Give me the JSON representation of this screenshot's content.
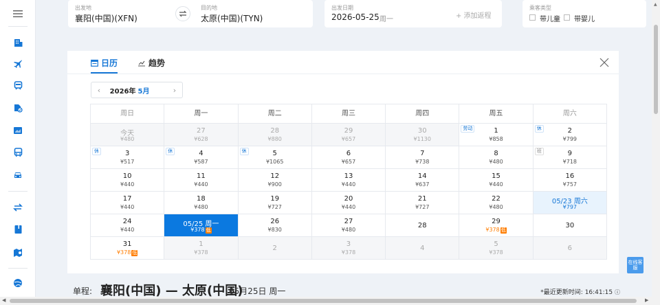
{
  "nav": {
    "icons": [
      "menu-icon",
      "hotel-icon",
      "flight-icon",
      "train-icon",
      "visa-icon",
      "ticket-icon",
      "bus-icon",
      "car-icon",
      "transfer-icon",
      "guide-icon",
      "map-icon",
      "globe-icon"
    ]
  },
  "search": {
    "from_label": "出发地",
    "from_value": "襄阳(中国)(XFN)",
    "to_label": "目的地",
    "to_value": "太原(中国)(TYN)",
    "date_label": "出发日期",
    "date_value": "2026-05-25",
    "date_weekday": "周一",
    "add_return": "+ 添加返程",
    "passenger_label": "乘客类型",
    "child_label": "带儿童",
    "infant_label": "带婴儿"
  },
  "calendar": {
    "tab_calendar": "日历",
    "tab_trend": "趋势",
    "year": "2026年",
    "month": "5月",
    "weekdays": [
      "周日",
      "周一",
      "周二",
      "周三",
      "周四",
      "周五",
      "周六"
    ],
    "rows": [
      [
        {
          "day": "今天",
          "price": "¥480",
          "state": "disabled"
        },
        {
          "day": "27",
          "price": "¥628",
          "state": "disabled"
        },
        {
          "day": "28",
          "price": "¥880",
          "state": "disabled"
        },
        {
          "day": "29",
          "price": "¥657",
          "state": "disabled"
        },
        {
          "day": "30",
          "price": "¥1130",
          "state": "disabled"
        },
        {
          "day": "1",
          "price": "¥858",
          "badge": "劳动"
        },
        {
          "day": "2",
          "price": "¥799",
          "badge": "休"
        }
      ],
      [
        {
          "day": "3",
          "price": "¥517",
          "badge": "休"
        },
        {
          "day": "4",
          "price": "¥587",
          "badge": "休"
        },
        {
          "day": "5",
          "price": "¥1065",
          "badge": "休"
        },
        {
          "day": "6",
          "price": "¥657"
        },
        {
          "day": "7",
          "price": "¥738"
        },
        {
          "day": "8",
          "price": "¥480"
        },
        {
          "day": "9",
          "price": "¥718",
          "badge": "班",
          "badge_style": "gray"
        }
      ],
      [
        {
          "day": "10",
          "price": "¥440"
        },
        {
          "day": "11",
          "price": "¥440"
        },
        {
          "day": "12",
          "price": "¥900"
        },
        {
          "day": "13",
          "price": "¥440"
        },
        {
          "day": "14",
          "price": "¥637"
        },
        {
          "day": "15",
          "price": "¥440"
        },
        {
          "day": "16",
          "price": "¥757"
        }
      ],
      [
        {
          "day": "17",
          "price": "¥440"
        },
        {
          "day": "18",
          "price": "¥480"
        },
        {
          "day": "19",
          "price": "¥727"
        },
        {
          "day": "20",
          "price": "¥440"
        },
        {
          "day": "21",
          "price": "¥727"
        },
        {
          "day": "22",
          "price": "¥480"
        },
        {
          "day": "05/23 周六",
          "price": "¥797",
          "state": "highlight"
        }
      ],
      [
        {
          "day": "24",
          "price": "¥440"
        },
        {
          "day": "05/25 周一",
          "price": "¥378",
          "low": "低",
          "state": "selected"
        },
        {
          "day": "26",
          "price": "¥830"
        },
        {
          "day": "27",
          "price": "¥480"
        },
        {
          "day": "28",
          "price": ""
        },
        {
          "day": "29",
          "price": "¥378",
          "low": "低"
        },
        {
          "day": "30",
          "price": ""
        }
      ],
      [
        {
          "day": "31",
          "price": "¥378",
          "low": "低"
        },
        {
          "day": "1",
          "price": "¥378",
          "state": "disabled"
        },
        {
          "day": "2",
          "price": "",
          "state": "disabled"
        },
        {
          "day": "3",
          "price": "¥378",
          "state": "disabled"
        },
        {
          "day": "4",
          "price": "",
          "state": "disabled"
        },
        {
          "day": "5",
          "price": "¥378",
          "state": "disabled"
        },
        {
          "day": "6",
          "price": "",
          "state": "disabled"
        }
      ]
    ]
  },
  "trip": {
    "label": "单程:",
    "cities": "襄阳(中国) — 太原(中国)",
    "date": "05月25日 周一",
    "updated": "*最近更新时间: 16:41:15"
  },
  "service_label": "在线客服",
  "colors": {
    "accent": "#1677d6",
    "selected": "#0b79e0",
    "low": "#ff7d00"
  }
}
